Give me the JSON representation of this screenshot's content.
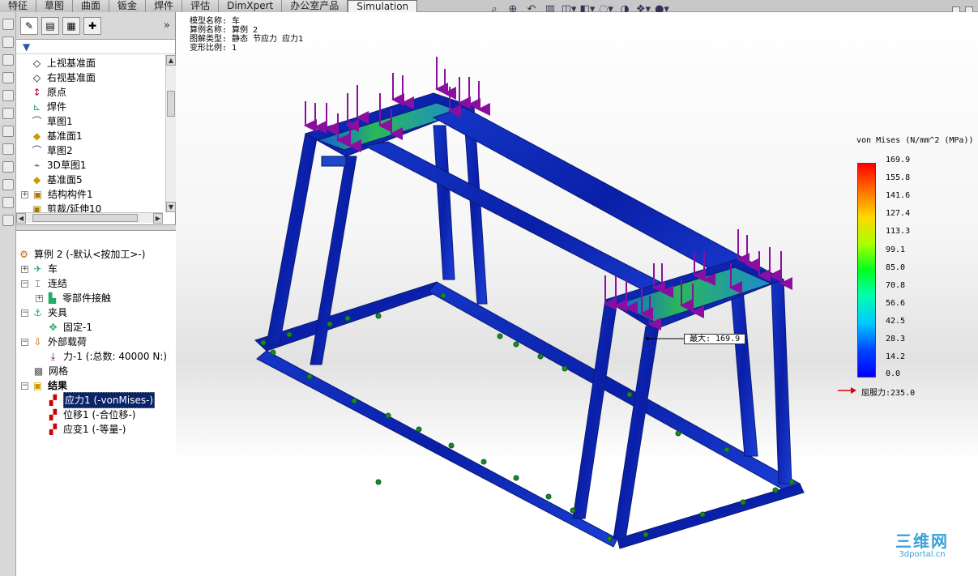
{
  "tabs": [
    "特征",
    "草图",
    "曲面",
    "钣金",
    "焊件",
    "评估",
    "DimXpert",
    "办公室产品",
    "Simulation"
  ],
  "active_tab": "Simulation",
  "view_toolbar_icons": [
    "zoom-to-fit-icon",
    "zoom-area-icon",
    "previous-view-icon",
    "section-view-icon",
    "view-orientation-icon",
    "display-style-icon",
    "hide-show-items-icon",
    "edit-appearance-icon",
    "apply-scene-icon",
    "view-settings-icon"
  ],
  "feature_tree": {
    "items": [
      {
        "label": "上视基准面",
        "icon": "plane-icon",
        "expand": ""
      },
      {
        "label": "右视基准面",
        "icon": "plane-icon",
        "expand": ""
      },
      {
        "label": "原点",
        "icon": "origin-icon",
        "expand": ""
      },
      {
        "label": "焊件",
        "icon": "weldment-icon",
        "expand": ""
      },
      {
        "label": "草图1",
        "icon": "sketch-icon",
        "expand": ""
      },
      {
        "label": "基准面1",
        "icon": "plane-icon",
        "expand": ""
      },
      {
        "label": "草图2",
        "icon": "sketch-icon",
        "expand": ""
      },
      {
        "label": "3D草图1",
        "icon": "sketch3d-icon",
        "expand": ""
      },
      {
        "label": "基准面5",
        "icon": "plane-icon",
        "expand": ""
      },
      {
        "label": "结构构件1",
        "icon": "structural-member-icon",
        "expand": "+"
      },
      {
        "label": "剪裁/延伸10",
        "icon": "trim-extend-icon",
        "expand": ""
      }
    ]
  },
  "sim_tree": {
    "study": "算例 2 (-默认<按加工>-)",
    "items": [
      {
        "label": "车",
        "level": 1,
        "expand": "+",
        "icon": "part-icon"
      },
      {
        "label": "连结",
        "level": 1,
        "expand": "−",
        "icon": "connections-icon"
      },
      {
        "label": "零部件接触",
        "level": 2,
        "expand": "+",
        "icon": "contact-icon"
      },
      {
        "label": "夹具",
        "level": 1,
        "expand": "−",
        "icon": "fixtures-icon"
      },
      {
        "label": "固定-1",
        "level": 2,
        "expand": "",
        "icon": "fixed-icon"
      },
      {
        "label": "外部载荷",
        "level": 1,
        "expand": "−",
        "icon": "loads-icon"
      },
      {
        "label": "力-1 (:总数: 40000 N:)",
        "level": 2,
        "expand": "",
        "icon": "force-icon"
      },
      {
        "label": "网格",
        "level": 1,
        "expand": "",
        "icon": "mesh-icon"
      },
      {
        "label": "结果",
        "level": 1,
        "expand": "−",
        "icon": "results-icon"
      },
      {
        "label": "应力1 (-vonMises-)",
        "level": 2,
        "expand": "",
        "icon": "stress-plot-icon",
        "selected": true
      },
      {
        "label": "位移1 (-合位移-)",
        "level": 2,
        "expand": "",
        "icon": "displacement-plot-icon"
      },
      {
        "label": "应变1 (-等量-)",
        "level": 2,
        "expand": "",
        "icon": "strain-plot-icon"
      }
    ]
  },
  "plot_info": {
    "line1": "模型名称: 车",
    "line2": "算例名称: 算例 2",
    "line3": "图解类型: 静态 节应力 应力1",
    "line4": "变形比例: 1"
  },
  "legend": {
    "title": "von Mises (N/mm^2 (MPa))",
    "values": [
      "169.9",
      "155.8",
      "141.6",
      "127.4",
      "113.3",
      "99.1",
      "85.0",
      "70.8",
      "56.6",
      "42.5",
      "28.3",
      "14.2",
      "0.0"
    ],
    "yield": "屈服力:235.0",
    "colors": {
      "max": "#ff0000",
      "mid": "#00ff20",
      "min": "#0000ff"
    }
  },
  "max_label": "最大:  169.9",
  "watermark": {
    "top": "三维网",
    "bottom": "3dportal.cn"
  }
}
